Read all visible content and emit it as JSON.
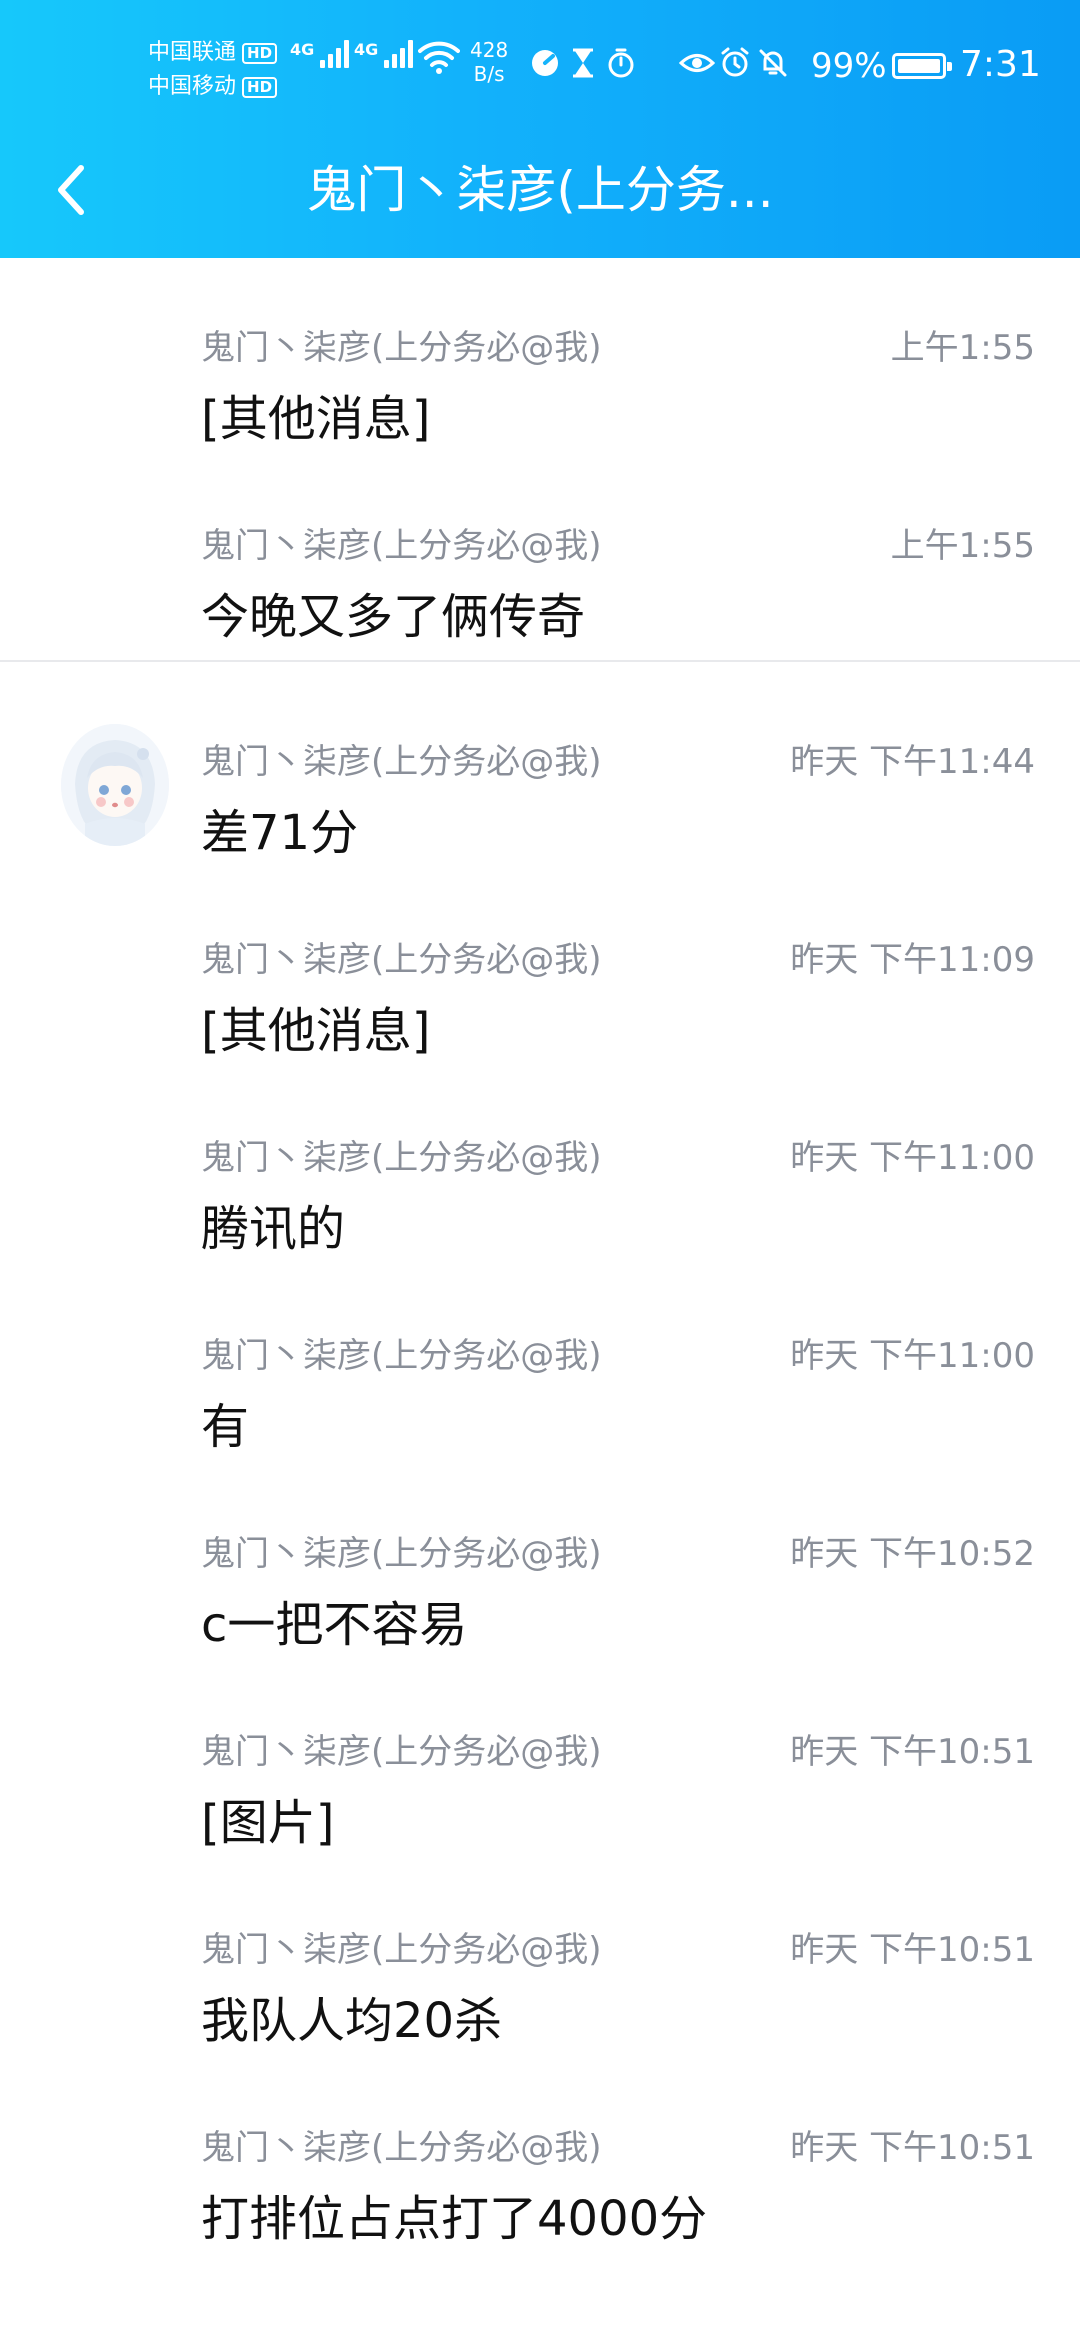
{
  "status_bar": {
    "carrier_1": "中国联通",
    "carrier_2": "中国移动",
    "hd_label": "HD",
    "network_gen": "4G",
    "net_speed_value": "428",
    "net_speed_unit": "B/s",
    "battery_percent": "99%",
    "battery_level": 0.99,
    "time": "7:31"
  },
  "header": {
    "title": "鬼门丶柒彦(上分务..."
  },
  "messages_group_1": [
    {
      "sender": "鬼门丶柒彦(上分务必@我)",
      "time": "上午1:55",
      "text": "[其他消息]"
    },
    {
      "sender": "鬼门丶柒彦(上分务必@我)",
      "time": "上午1:55",
      "text": "今晚又多了俩传奇"
    }
  ],
  "messages_group_2": [
    {
      "sender": "鬼门丶柒彦(上分务必@我)",
      "time": "昨天 下午11:44",
      "text": "差71分"
    },
    {
      "sender": "鬼门丶柒彦(上分务必@我)",
      "time": "昨天 下午11:09",
      "text": "[其他消息]"
    },
    {
      "sender": "鬼门丶柒彦(上分务必@我)",
      "time": "昨天 下午11:00",
      "text": "腾讯的"
    },
    {
      "sender": "鬼门丶柒彦(上分务必@我)",
      "time": "昨天 下午11:00",
      "text": "有"
    },
    {
      "sender": "鬼门丶柒彦(上分务必@我)",
      "time": "昨天 下午10:52",
      "text": "c一把不容易"
    },
    {
      "sender": "鬼门丶柒彦(上分务必@我)",
      "time": "昨天 下午10:51",
      "text": "[图片]"
    },
    {
      "sender": "鬼门丶柒彦(上分务必@我)",
      "time": "昨天 下午10:51",
      "text": "我队人均20杀"
    },
    {
      "sender": "鬼门丶柒彦(上分务必@我)",
      "time": "昨天 下午10:51",
      "text": "打排位占点打了4000分"
    }
  ],
  "icons": {
    "back": "chevron-left-icon",
    "wifi": "wifi-icon",
    "avatar": "user-avatar"
  }
}
